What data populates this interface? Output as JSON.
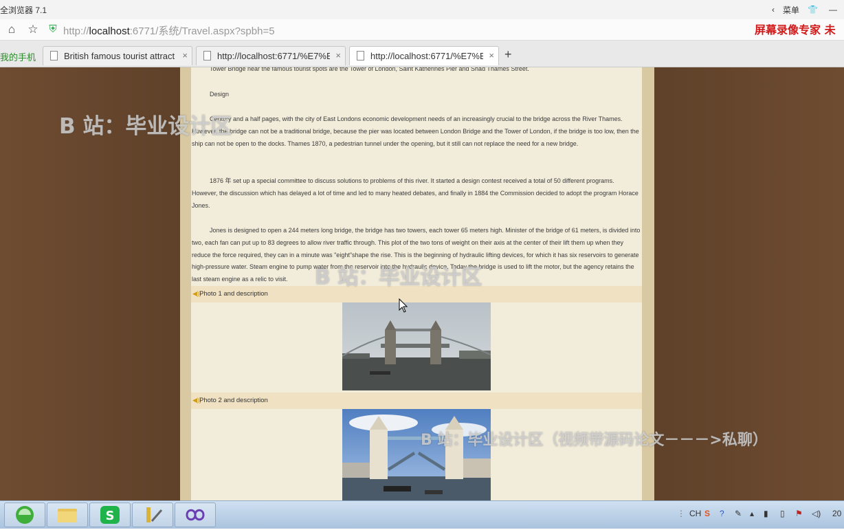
{
  "browser": {
    "title": "全浏览器 7.1",
    "menu_label": "菜单",
    "url": {
      "scheme": "http://",
      "host": "localhost",
      "rest": ":6771/系统/Travel.aspx?spbh=5"
    },
    "recorder_brand": "屏幕录像专家 未",
    "phone_tab": "我的手机",
    "tabs": [
      {
        "label": "British famous tourist attract"
      },
      {
        "label": "http://localhost:6771/%E7%E"
      },
      {
        "label": "http://localhost:6771/%E7%E"
      }
    ],
    "new_tab": "+",
    "close_glyph": "×"
  },
  "article": {
    "intro": "Tower Bridge near the famous tourist spots are the Tower of London, Saint Katherines Pier and Shad Thames Street.",
    "design_heading": "Design",
    "p1": "Century and a half pages, with the city of East Londons economic development needs of an increasingly crucial to the bridge across the River Thames. However, the bridge can not be a traditional bridge, because the pier was located between London Bridge and the Tower of London, if the bridge is too low, then the ship can not be open to the docks. Thames 1870, a pedestrian tunnel under the opening, but it still can not replace the need for a new bridge.",
    "p2": "1876 年 set up a special committee to discuss solutions to problems of this river. It started a design contest received a total of 50 different programs. However, the discussion which has delayed a lot of time and led to many heated debates, and finally in 1884 the Commission decided to adopt the program Horace Jones.",
    "p3": "Jones is designed to open a 244 meters long bridge, the bridge has two towers, each tower 65 meters high. Minister of the bridge of 61 meters, is divided into two, each fan can put up to 83 degrees to allow river traffic through. This plot of the two tons of weight on their axis at the center of their lift them up when they reduce the force required, they can in a minute was \"eight\"shape the rise. This is the beginning of hydraulic lifting devices, for which it has six reservoirs to generate high-pressure water. Steam engine to pump water from the reservoir into the hydraulic device. Today the bridge is used to lift the motor, but the agency retains the last steam engine as a relic to visit.",
    "photo1_label": "Photo 1 and description",
    "photo2_label": "Photo 2 and description"
  },
  "watermarks": {
    "left": "B 站：毕业设计区",
    "center": "B 站：毕业设计区",
    "bottom": "B 站：毕业设计区（视频带源码论文－－－>私聊）"
  },
  "taskbar": {
    "ime": "CH",
    "clock": "20"
  },
  "colors": {
    "wood": "#6a4a30",
    "paper": "#f2ecda",
    "photo_header": "#efe1c2",
    "brand_red": "#d21a1a"
  }
}
